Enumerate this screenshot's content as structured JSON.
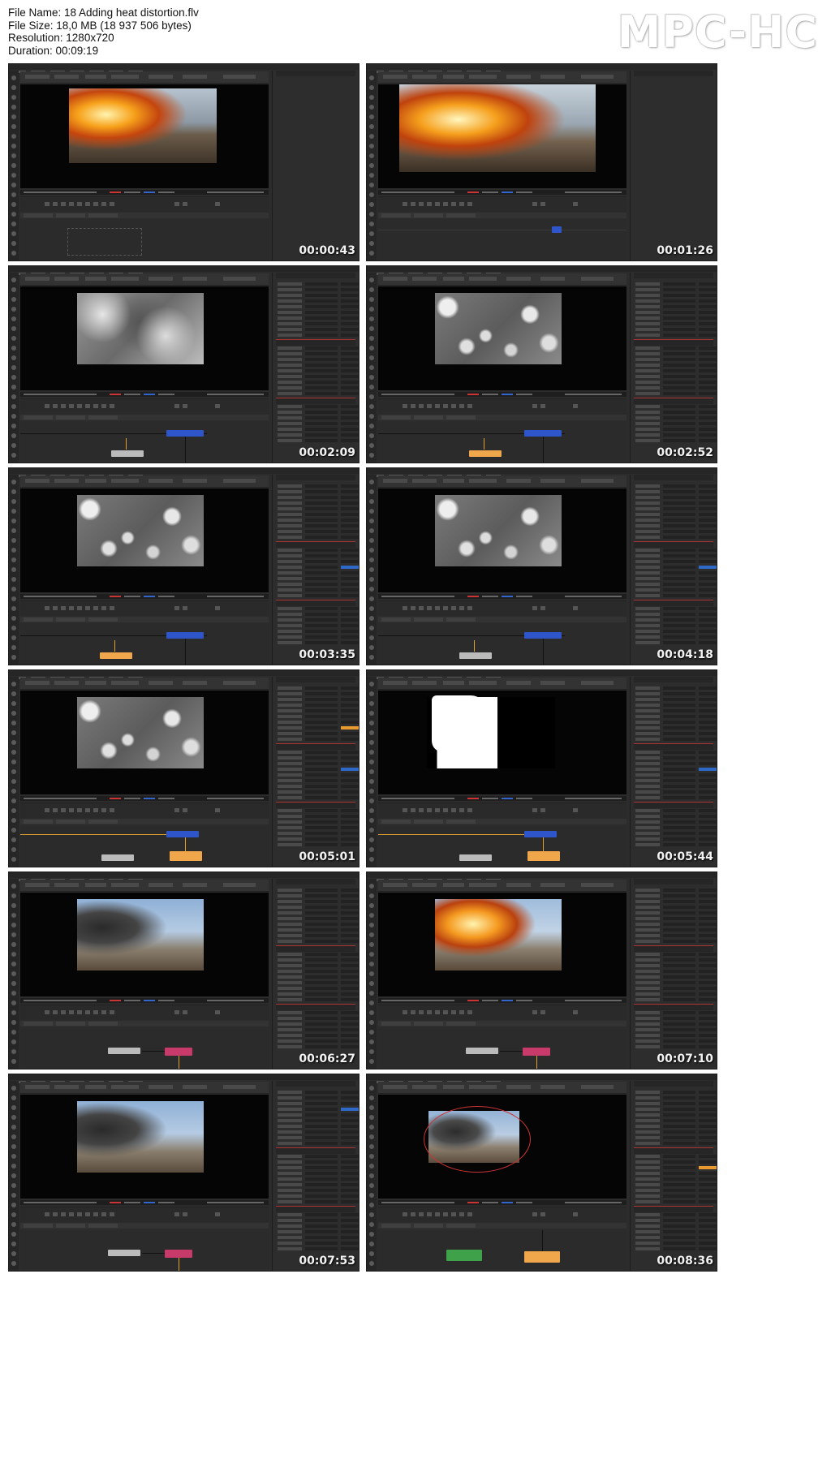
{
  "file_info": {
    "file_name": "File Name: 18 Adding heat distortion.flv",
    "file_size": "File Size: 18,0 MB (18 937 506 bytes)",
    "resolution": "Resolution: 1280x720",
    "duration": "Duration: 00:09:19"
  },
  "player_logo": "MPC-HC",
  "thumbnails": [
    {
      "timestamp": "00:00:43",
      "viewer": "explosion-robot"
    },
    {
      "timestamp": "00:01:26",
      "viewer": "explosion-robot-zoom"
    },
    {
      "timestamp": "00:02:09",
      "viewer": "clouds"
    },
    {
      "timestamp": "00:02:52",
      "viewer": "noise"
    },
    {
      "timestamp": "00:03:35",
      "viewer": "noise"
    },
    {
      "timestamp": "00:04:18",
      "viewer": "noise"
    },
    {
      "timestamp": "00:05:01",
      "viewer": "noise"
    },
    {
      "timestamp": "00:05:44",
      "viewer": "matte"
    },
    {
      "timestamp": "00:06:27",
      "viewer": "smoke-city"
    },
    {
      "timestamp": "00:07:10",
      "viewer": "explosion-city"
    },
    {
      "timestamp": "00:07:53",
      "viewer": "smoke-city"
    },
    {
      "timestamp": "00:08:36",
      "viewer": "smoke-city-ellipse"
    }
  ],
  "colors": {
    "ui_bg": "#2c2c2c",
    "node_blue": "#2e55c9",
    "node_orange": "#f0a64a",
    "node_pink": "#c83a6a",
    "node_green": "#3fa14a",
    "wire": "#e0a030",
    "selection_orange": "#e89a2e",
    "slider_blue": "#2f69c8"
  }
}
